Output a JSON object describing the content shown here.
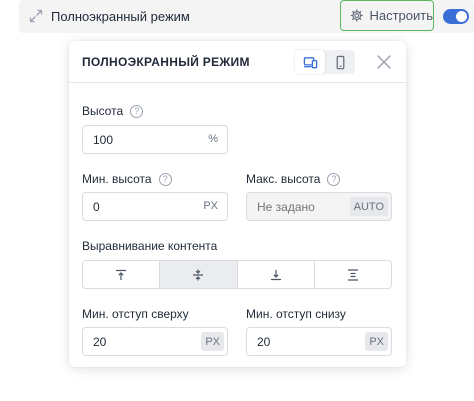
{
  "topbar": {
    "title": "Полноэкранный режим",
    "configure_label": "Настроить",
    "toggle_on": true
  },
  "panel": {
    "title": "ПОЛНОЭКРАННЫЙ РЕЖИМ",
    "devices": [
      {
        "name": "desktop",
        "active": true
      },
      {
        "name": "mobile",
        "active": false
      }
    ],
    "height": {
      "label": "Высота",
      "value": "100",
      "unit": "%"
    },
    "min_height": {
      "label": "Мин. высота",
      "value": "0",
      "unit": "PX"
    },
    "max_height": {
      "label": "Макс. высота",
      "placeholder": "Не задано",
      "unit": "AUTO"
    },
    "alignment": {
      "label": "Выравнивание контента",
      "options": [
        "top",
        "center",
        "bottom",
        "stretch"
      ],
      "active_index": 1
    },
    "padding_top": {
      "label": "Мин. отступ сверху",
      "value": "20",
      "unit": "PX"
    },
    "padding_bottom": {
      "label": "Мин. отступ снизу",
      "value": "20",
      "unit": "PX"
    }
  },
  "colors": {
    "accent": "#3b6fd8",
    "highlight_border": "#5bb85d",
    "topbar_bg": "#f4f4f5"
  }
}
